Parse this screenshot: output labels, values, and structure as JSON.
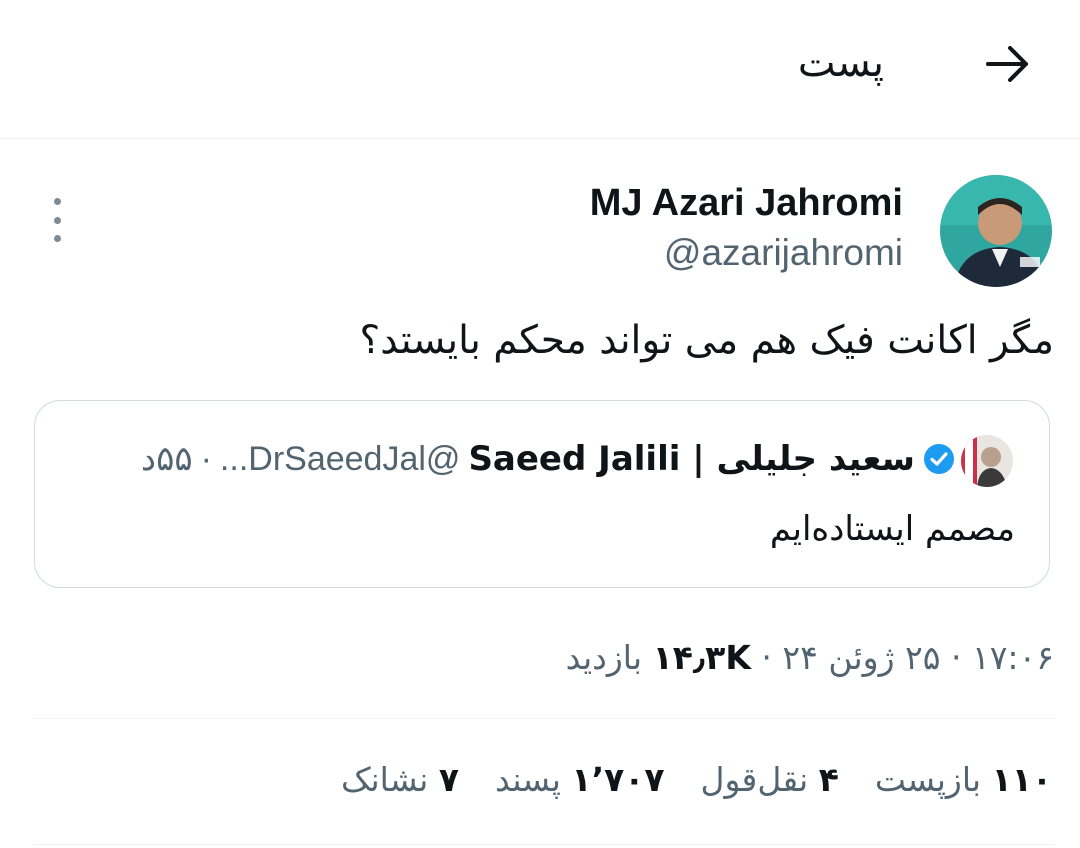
{
  "header": {
    "title": "پست",
    "back_icon": "arrow-right-icon"
  },
  "author": {
    "name": "MJ Azari Jahromi",
    "handle": "@azarijahromi"
  },
  "tweet": {
    "text": "مگر اکانت فیک هم می تواند محکم بایستد؟"
  },
  "quote": {
    "name": "سعید جلیلی | Saeed Jalili",
    "handle": "@DrSaeedJal...",
    "age": "۵۵د",
    "separator": "·",
    "text": "مصمم ایستاده‌ایم"
  },
  "meta": {
    "time": "۱۷:۰۶",
    "date": "۲۵ ژوئن ۲۴",
    "views_count": "۱۴٫۳K",
    "views_label": "بازدید",
    "separator": "·"
  },
  "stats": {
    "reposts_count": "۱۱۰",
    "reposts_label": "بازپست",
    "quotes_count": "۴",
    "quotes_label": "نقل‌قول",
    "likes_count": "۱٬۷۰۷",
    "likes_label": "پسند",
    "bookmarks_count": "۷",
    "bookmarks_label": "نشانک"
  },
  "colors": {
    "verified": "#1d9bf0",
    "secondary_text": "#536471",
    "divider": "#eff3f4"
  }
}
